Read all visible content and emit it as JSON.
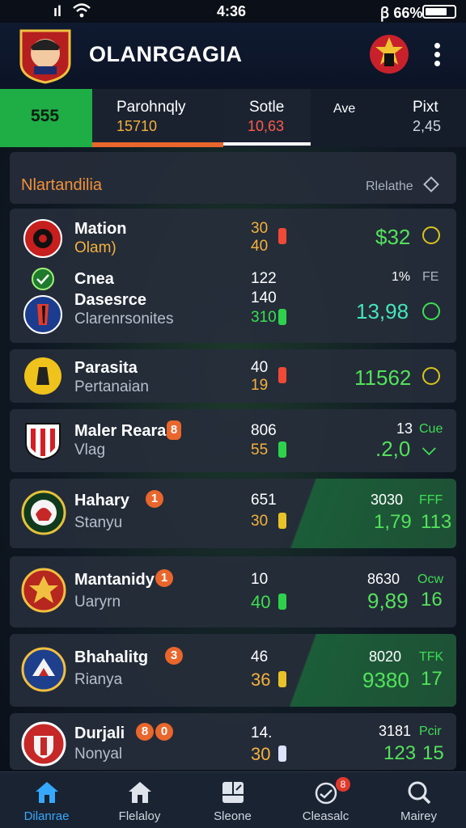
{
  "status_bar": {
    "left": "ıl",
    "time": "4:36",
    "right": "ꞵ 66%"
  },
  "header": {
    "title": "OLANRGAGIA"
  },
  "tabs": [
    {
      "label": "555",
      "value": ""
    },
    {
      "label": "Parohnqly",
      "value": "15710"
    },
    {
      "label": "Sotle",
      "value": "10,63"
    },
    {
      "label": "Ave",
      "value": ""
    },
    {
      "label": "Pixt",
      "value": "2,45"
    }
  ],
  "section": {
    "title": "Nlartandilia",
    "filter": "Rlelathe"
  },
  "cards": [
    {
      "rows": [
        {
          "name": "Mation",
          "sub": "Olam)",
          "n1": "30",
          "n2": "40",
          "right": "$32"
        },
        {
          "name": "Cnea",
          "sub": "",
          "n1": "122",
          "right_small": "1%",
          "right_muted": "FE"
        },
        {
          "name": "Dasesrce",
          "sub": "Clarenrsonites",
          "n1": "140",
          "n2": "310",
          "right": "13,98"
        }
      ]
    },
    {
      "name": "Parasita",
      "sub": "Pertanaian",
      "n1": "40",
      "n2": "19",
      "right": "11562"
    },
    {
      "name": "Maler Reara",
      "badge": "8",
      "sub": "Vlag",
      "n1": "806",
      "n2": "55",
      "right_top": "13",
      "right_small": "Cue",
      "right": ".2,0"
    },
    {
      "name": "Hahary",
      "badge": "1",
      "sub": "Stanyu",
      "n1": "651",
      "n2": "30",
      "right_top": "3030",
      "right_small": "FFF",
      "right": "1,79",
      "right_2": "113"
    },
    {
      "name": "Mantanidy",
      "badge": "1",
      "sub": "Uaryrn",
      "n1": "10",
      "n2": "40",
      "right_top": "8630",
      "right_small": "Ocw",
      "right": "9,89",
      "right_2": "16"
    },
    {
      "name": "Bhahalitg",
      "badge": "3",
      "sub": "Rianya",
      "n1": "46",
      "n2": "36",
      "right_top": "8020",
      "right_small": "TFK",
      "right": "9380",
      "right_2": "17"
    },
    {
      "name": "Durjali",
      "badge": "8",
      "badge2": "0",
      "sub": "Nonyal",
      "n1": "14.",
      "n2": "30",
      "right_top": "3181",
      "right_small": "Pcir",
      "right": "123",
      "right_2": "15"
    }
  ],
  "nav": [
    {
      "label": "Dilanrae",
      "icon": "home-icon",
      "active": true
    },
    {
      "label": "Flelaloy",
      "icon": "house-icon"
    },
    {
      "label": "Sleone",
      "icon": "board-icon"
    },
    {
      "label": "Cleasalc",
      "icon": "clock-icon",
      "badge": "8"
    },
    {
      "label": "Mairey",
      "icon": "search-icon"
    }
  ],
  "colors": {
    "accent_green": "#1fae46",
    "accent_orange": "#e9662c",
    "accent_red": "#ff5b4a",
    "nav_active": "#36a9ff"
  }
}
